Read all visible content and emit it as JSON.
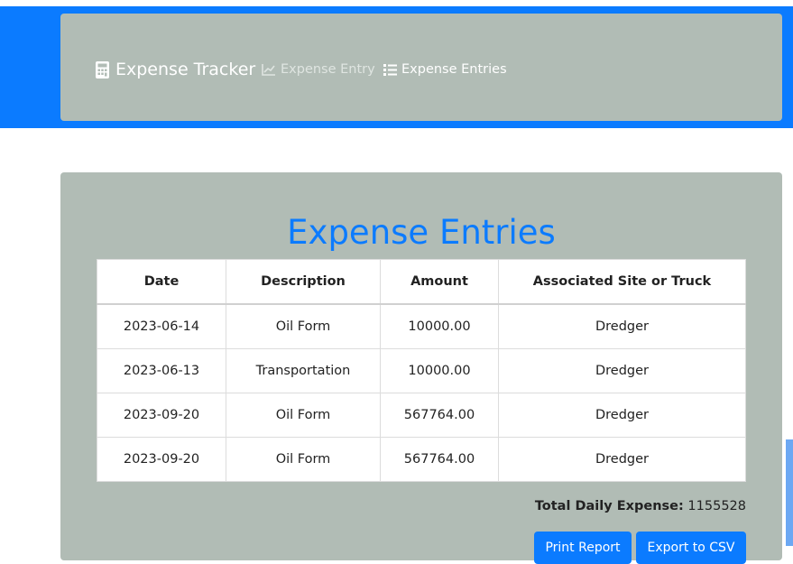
{
  "navbar": {
    "brand": "Expense Tracker",
    "links": [
      {
        "label": "Expense Entry",
        "icon": "chart-line-icon"
      },
      {
        "label": "Expense Entries",
        "icon": "list-icon"
      }
    ]
  },
  "main": {
    "title": "Expense Entries",
    "table": {
      "headers": [
        "Date",
        "Description",
        "Amount",
        "Associated Site or Truck"
      ],
      "rows": [
        [
          "2023-06-14",
          "Oil Form",
          "10000.00",
          "Dredger"
        ],
        [
          "2023-06-13",
          "Transportation",
          "10000.00",
          "Dredger"
        ],
        [
          "2023-09-20",
          "Oil Form",
          "567764.00",
          "Dredger"
        ],
        [
          "2023-09-20",
          "Oil Form",
          "567764.00",
          "Dredger"
        ]
      ]
    },
    "total_label": "Total Daily Expense:",
    "total_value": "1155528",
    "buttons": {
      "print": "Print Report",
      "export": "Export to CSV"
    }
  },
  "colors": {
    "accent": "#0b7bff",
    "panel": "#b1bcb5"
  }
}
